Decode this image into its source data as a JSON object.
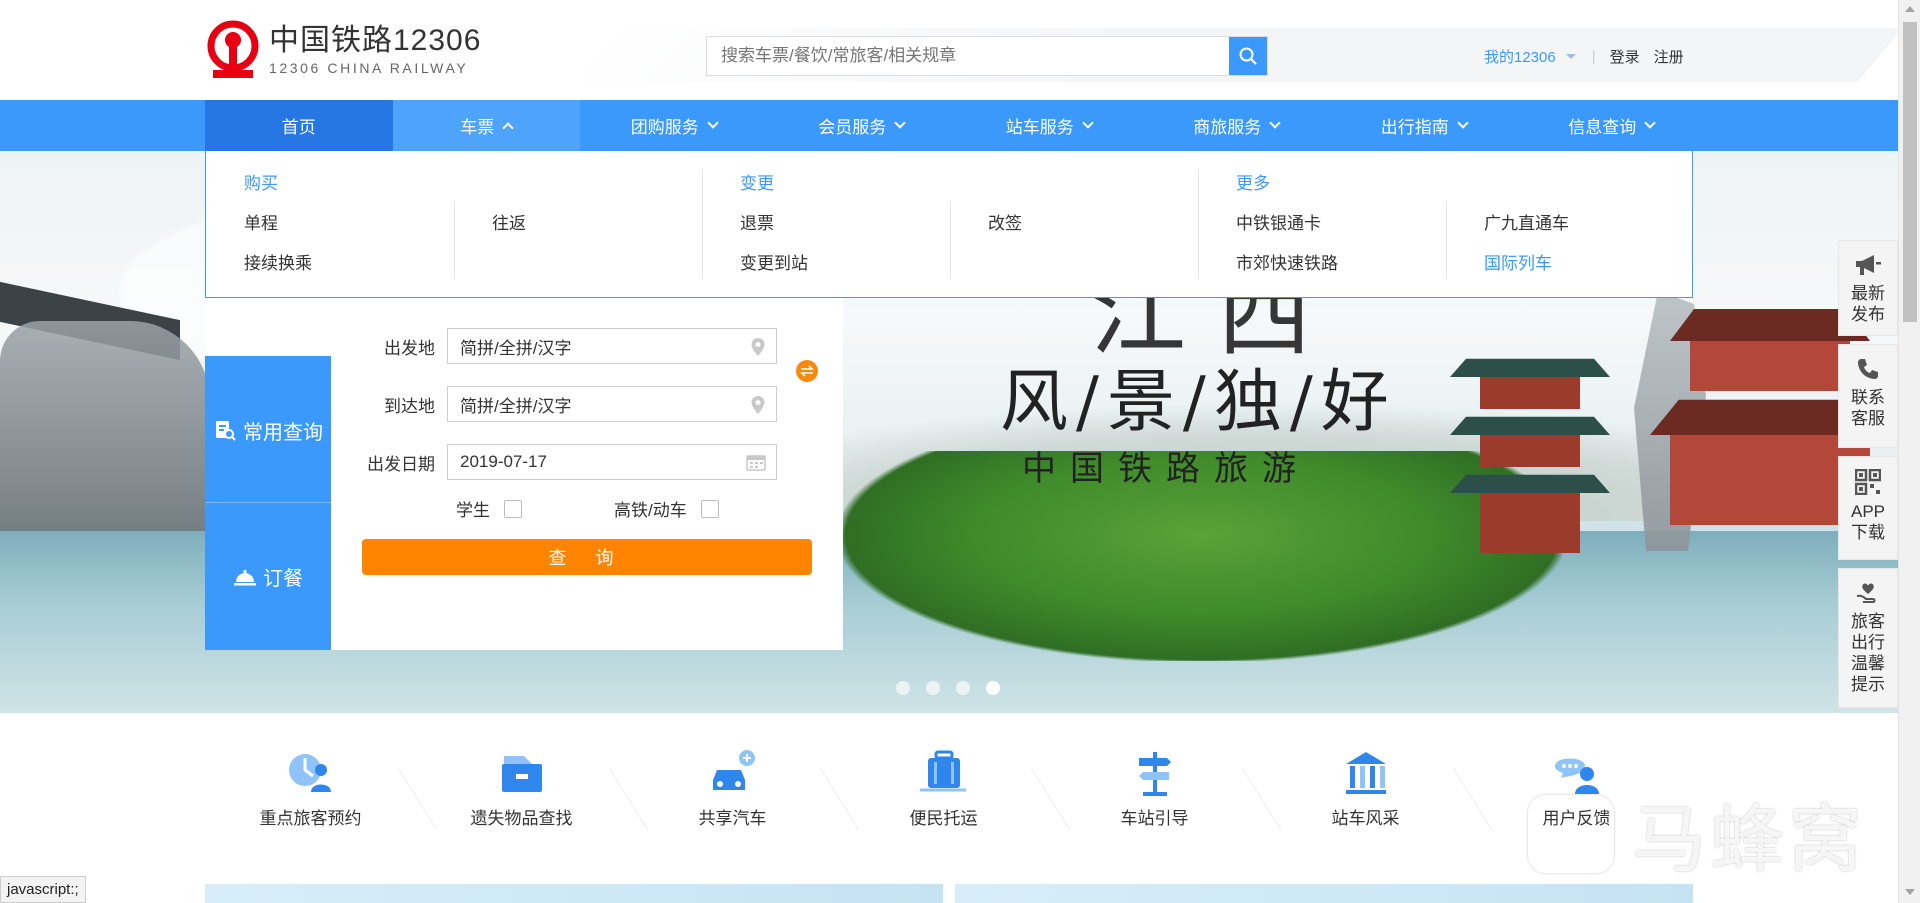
{
  "header": {
    "logo_cn": "中国铁路12306",
    "logo_en": "12306 CHINA RAILWAY",
    "search_placeholder": "搜索车票/餐饮/常旅客/相关规章",
    "my12306": "我的12306",
    "separator": "|",
    "login": "登录",
    "register": "注册"
  },
  "nav": {
    "items": [
      {
        "label": "首页"
      },
      {
        "label": "车票"
      },
      {
        "label": "团购服务"
      },
      {
        "label": "会员服务"
      },
      {
        "label": "站车服务"
      },
      {
        "label": "商旅服务"
      },
      {
        "label": "出行指南"
      },
      {
        "label": "信息查询"
      }
    ]
  },
  "ticket_menu": {
    "buy": {
      "heading": "购买",
      "links": [
        "单程",
        "往返",
        "接续换乘"
      ]
    },
    "change": {
      "heading": "变更",
      "links": [
        "退票",
        "改签",
        "变更到站"
      ]
    },
    "more": {
      "heading": "更多",
      "links": [
        "中铁银通卡",
        "广九直通车",
        "市郊快速铁路",
        "国际列车"
      ]
    }
  },
  "booking": {
    "tabs": [
      "常用查询",
      "订餐"
    ],
    "from_label": "出发地",
    "from_placeholder": "简拼/全拼/汉字",
    "to_label": "到达地",
    "to_placeholder": "简拼/全拼/汉字",
    "date_label": "出发日期",
    "date_value": "2019-07-17",
    "student_label": "学生",
    "gaotie_label": "高铁/动车",
    "query_button": "查 询"
  },
  "banner": {
    "big_text": "江西",
    "title": "风/景/独/好",
    "subtitle": "中国铁路旅游",
    "dot_count": 4,
    "active_dot": 4
  },
  "sidebar": {
    "items": [
      {
        "label": "最新发布",
        "icon": "megaphone-icon"
      },
      {
        "label": "联系客服",
        "icon": "phone-icon"
      },
      {
        "label": "APP下载",
        "icon": "qr-code-icon"
      },
      {
        "label": "旅客出行温馨提示",
        "icon": "heart-hand-icon"
      }
    ]
  },
  "services": [
    {
      "label": "重点旅客预约",
      "icon": "vip-passenger-icon"
    },
    {
      "label": "遗失物品查找",
      "icon": "lost-found-icon"
    },
    {
      "label": "共享汽车",
      "icon": "car-share-icon"
    },
    {
      "label": "便民托运",
      "icon": "luggage-icon"
    },
    {
      "label": "车站引导",
      "icon": "signpost-icon"
    },
    {
      "label": "站车风采",
      "icon": "building-icon"
    },
    {
      "label": "用户反馈",
      "icon": "feedback-icon"
    }
  ],
  "statusbar": "javascript:;",
  "watermark": "马蜂窝",
  "colors": {
    "primary": "#3b99fc",
    "nav_home": "#2676e3",
    "query_button": "#ff8400",
    "logo_red": "#e60012"
  }
}
